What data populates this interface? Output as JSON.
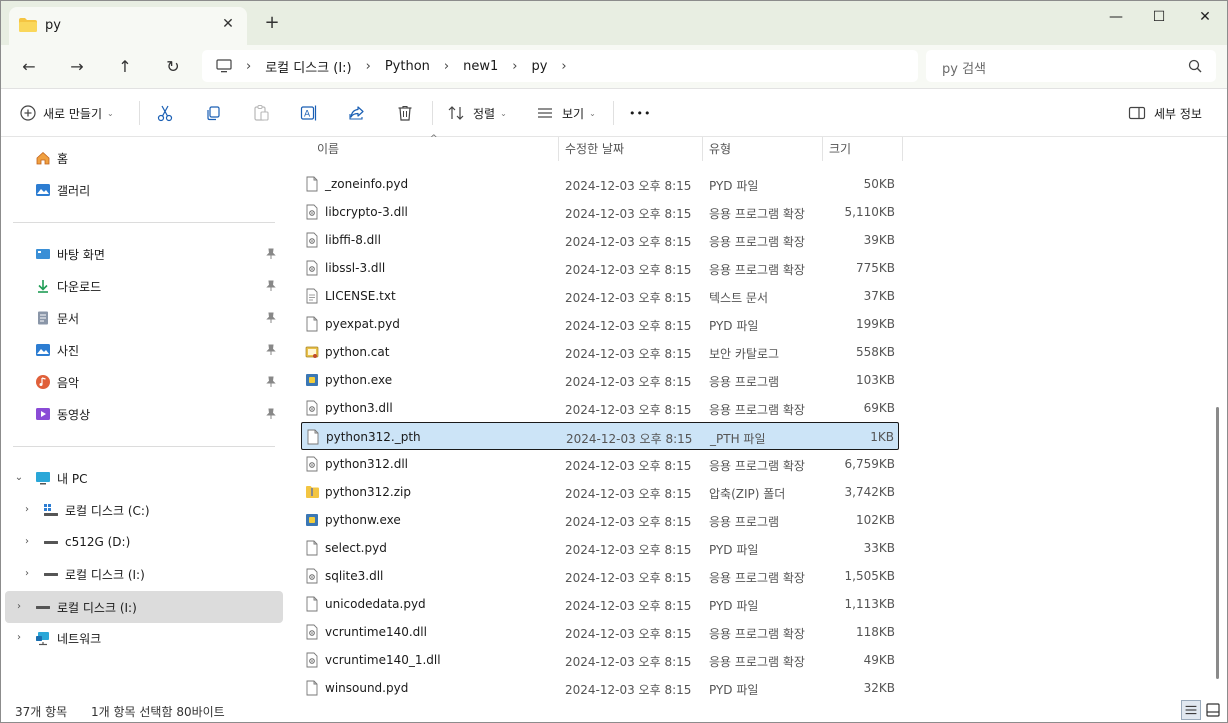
{
  "window": {
    "tab_title": "py",
    "tab_close": "✕",
    "new_tab": "+",
    "minimize": "—",
    "maximize": "☐",
    "close": "✕"
  },
  "nav": {
    "back": "←",
    "forward": "→",
    "up": "↑",
    "refresh": "↻"
  },
  "breadcrumb": [
    "로컬 디스크 (I:)",
    "Python",
    "new1",
    "py"
  ],
  "search": {
    "placeholder": "py 검색"
  },
  "toolbar": {
    "new_label": "새로 만들기",
    "sort_label": "정렬",
    "view_label": "보기",
    "more_label": "•••",
    "details_label": "세부 정보"
  },
  "sidebar": {
    "home": "홈",
    "gallery": "갤러리",
    "quick": [
      {
        "label": "바탕 화면",
        "icon": "desktop-icon"
      },
      {
        "label": "다운로드",
        "icon": "download-icon"
      },
      {
        "label": "문서",
        "icon": "documents-icon"
      },
      {
        "label": "사진",
        "icon": "pictures-icon"
      },
      {
        "label": "음악",
        "icon": "music-icon"
      },
      {
        "label": "동영상",
        "icon": "videos-icon"
      }
    ],
    "this_pc": "내 PC",
    "drives": [
      {
        "label": "로컬 디스크 (C:)"
      },
      {
        "label": "c512G (D:)"
      },
      {
        "label": "로컬 디스크 (I:)"
      }
    ],
    "selected_drive": "로컬 디스크 (I:)",
    "network": "네트워크"
  },
  "columns": {
    "name": "이름",
    "date": "수정한 날짜",
    "type": "유형",
    "size": "크기"
  },
  "files": [
    {
      "name": "_zoneinfo.pyd",
      "date": "2024-12-03 오후 8:15",
      "type": "PYD 파일",
      "size": "50KB",
      "icon": "file"
    },
    {
      "name": "libcrypto-3.dll",
      "date": "2024-12-03 오후 8:15",
      "type": "응용 프로그램 확장",
      "size": "5,110KB",
      "icon": "dll"
    },
    {
      "name": "libffi-8.dll",
      "date": "2024-12-03 오후 8:15",
      "type": "응용 프로그램 확장",
      "size": "39KB",
      "icon": "dll"
    },
    {
      "name": "libssl-3.dll",
      "date": "2024-12-03 오후 8:15",
      "type": "응용 프로그램 확장",
      "size": "775KB",
      "icon": "dll"
    },
    {
      "name": "LICENSE.txt",
      "date": "2024-12-03 오후 8:15",
      "type": "텍스트 문서",
      "size": "37KB",
      "icon": "txt"
    },
    {
      "name": "pyexpat.pyd",
      "date": "2024-12-03 오후 8:15",
      "type": "PYD 파일",
      "size": "199KB",
      "icon": "file"
    },
    {
      "name": "python.cat",
      "date": "2024-12-03 오후 8:15",
      "type": "보안 카탈로그",
      "size": "558KB",
      "icon": "cat"
    },
    {
      "name": "python.exe",
      "date": "2024-12-03 오후 8:15",
      "type": "응용 프로그램",
      "size": "103KB",
      "icon": "exe"
    },
    {
      "name": "python3.dll",
      "date": "2024-12-03 오후 8:15",
      "type": "응용 프로그램 확장",
      "size": "69KB",
      "icon": "dll"
    },
    {
      "name": "python312._pth",
      "date": "2024-12-03 오후 8:15",
      "type": "_PTH 파일",
      "size": "1KB",
      "icon": "file"
    },
    {
      "name": "python312.dll",
      "date": "2024-12-03 오후 8:15",
      "type": "응용 프로그램 확장",
      "size": "6,759KB",
      "icon": "dll"
    },
    {
      "name": "python312.zip",
      "date": "2024-12-03 오후 8:15",
      "type": "압축(ZIP) 폴더",
      "size": "3,742KB",
      "icon": "zip"
    },
    {
      "name": "pythonw.exe",
      "date": "2024-12-03 오후 8:15",
      "type": "응용 프로그램",
      "size": "102KB",
      "icon": "exe"
    },
    {
      "name": "select.pyd",
      "date": "2024-12-03 오후 8:15",
      "type": "PYD 파일",
      "size": "33KB",
      "icon": "file"
    },
    {
      "name": "sqlite3.dll",
      "date": "2024-12-03 오후 8:15",
      "type": "응용 프로그램 확장",
      "size": "1,505KB",
      "icon": "dll"
    },
    {
      "name": "unicodedata.pyd",
      "date": "2024-12-03 오후 8:15",
      "type": "PYD 파일",
      "size": "1,113KB",
      "icon": "file"
    },
    {
      "name": "vcruntime140.dll",
      "date": "2024-12-03 오후 8:15",
      "type": "응용 프로그램 확장",
      "size": "118KB",
      "icon": "dll"
    },
    {
      "name": "vcruntime140_1.dll",
      "date": "2024-12-03 오후 8:15",
      "type": "응용 프로그램 확장",
      "size": "49KB",
      "icon": "dll"
    },
    {
      "name": "winsound.pyd",
      "date": "2024-12-03 오후 8:15",
      "type": "PYD 파일",
      "size": "32KB",
      "icon": "file"
    }
  ],
  "selected_file": "python312._pth",
  "status": {
    "count": "37개 항목",
    "selection": "1개 항목 선택함 80바이트"
  },
  "colors": {
    "accent": "#0067c0",
    "selection_bg": "#cce4f7",
    "titlebar_bg": "#e8eee2"
  }
}
